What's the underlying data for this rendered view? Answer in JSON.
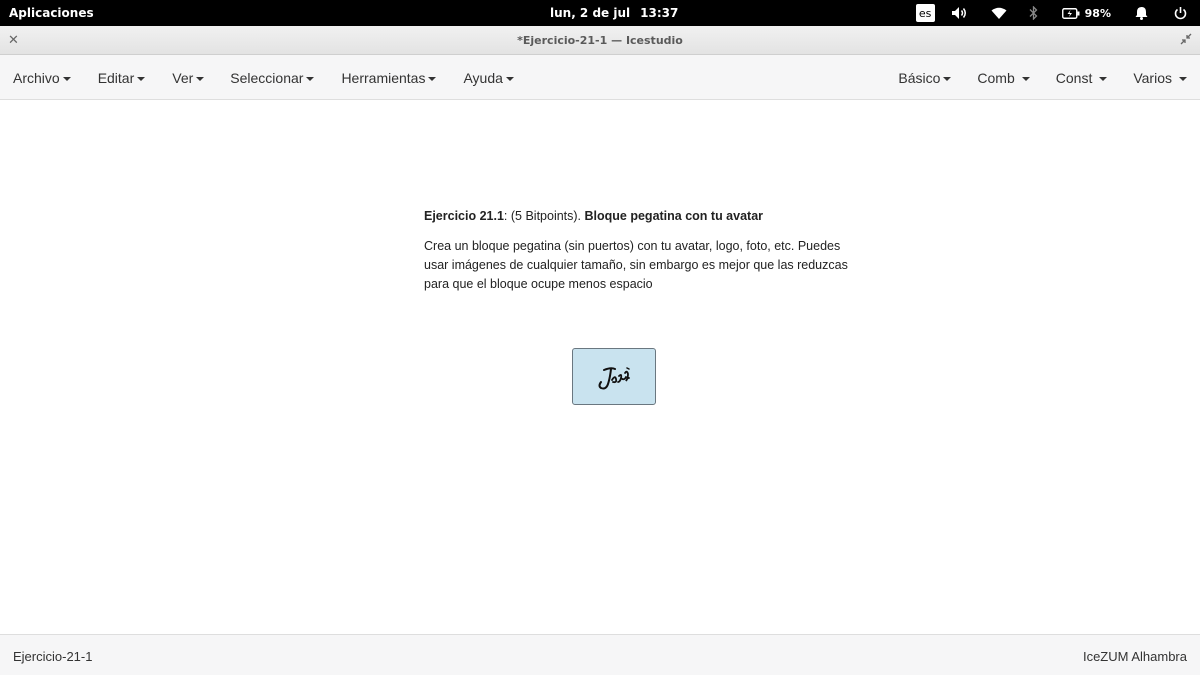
{
  "topbar": {
    "applications": "Aplicaciones",
    "date": "lun,  2 de jul",
    "time": "13:37",
    "language": "es",
    "battery": "98%"
  },
  "window": {
    "title": "*Ejercicio-21-1 — Icestudio"
  },
  "menubar": {
    "left": [
      {
        "label": "Archivo"
      },
      {
        "label": "Editar"
      },
      {
        "label": "Ver"
      },
      {
        "label": "Seleccionar"
      },
      {
        "label": "Herramientas"
      },
      {
        "label": "Ayuda"
      }
    ],
    "right": [
      {
        "label": "Básico"
      },
      {
        "label": "Comb"
      },
      {
        "label": "Const"
      },
      {
        "label": "Varios"
      }
    ]
  },
  "info_block": {
    "heading_bold": "Ejercicio 21.1",
    "heading_mid": ": (5 Bitpoints). ",
    "heading_title": "Bloque pegatina con tu avatar",
    "body": "Crea un bloque pegatina (sin puertos) con tu avatar, logo, foto, etc. Puedes usar imágenes de cualquier tamaño, sin embargo es mejor que las reduzcas para que el bloque ocupe menos espacio"
  },
  "sticker": {
    "image": "signature-image"
  },
  "footer": {
    "project": "Ejercicio-21-1",
    "board": "IceZUM Alhambra"
  },
  "colors": {
    "sticker_bg": "#c9e3ef",
    "topbar_bg": "#000000",
    "menubar_bg": "#f6f6f7"
  }
}
